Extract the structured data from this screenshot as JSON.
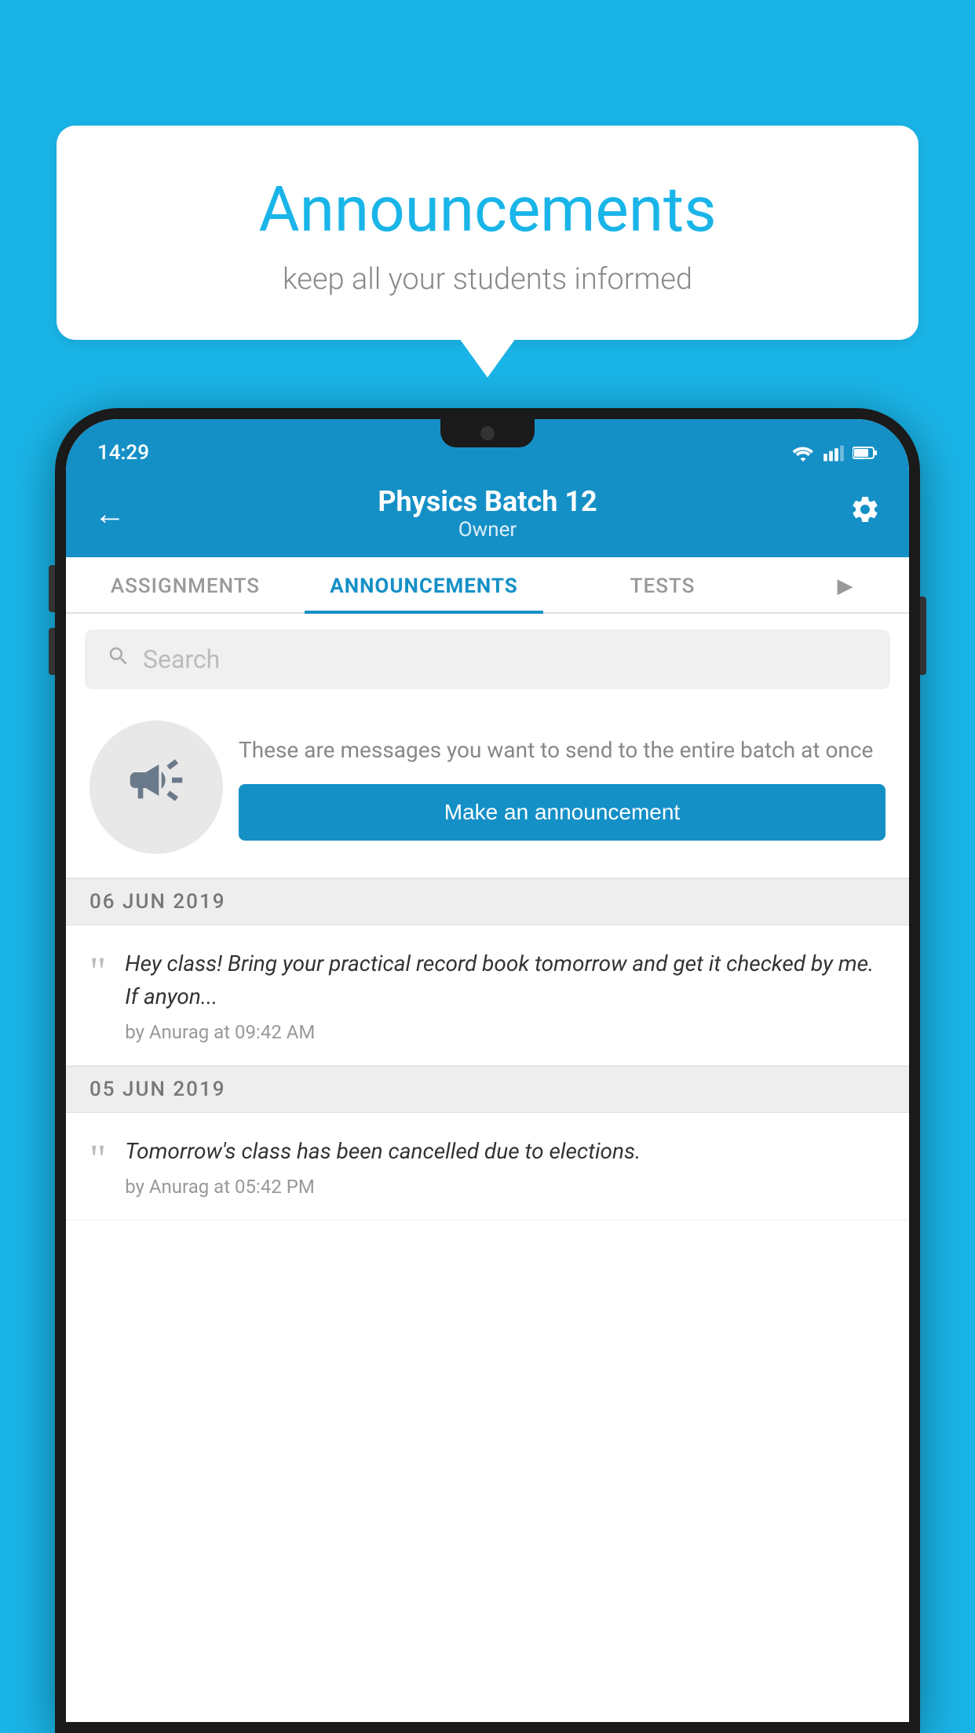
{
  "bubble": {
    "title": "Announcements",
    "subtitle": "keep all your students informed"
  },
  "statusBar": {
    "time": "14:29",
    "icons": [
      "wifi",
      "signal",
      "battery"
    ]
  },
  "header": {
    "title": "Physics Batch 12",
    "subtitle": "Owner",
    "back_label": "←",
    "gear_label": "⚙"
  },
  "tabs": [
    {
      "label": "ASSIGNMENTS",
      "active": false
    },
    {
      "label": "ANNOUNCEMENTS",
      "active": true
    },
    {
      "label": "TESTS",
      "active": false
    },
    {
      "label": "",
      "active": false,
      "partial": true
    }
  ],
  "search": {
    "placeholder": "Search"
  },
  "promo": {
    "description": "These are messages you want to send to the entire batch at once",
    "button_label": "Make an announcement"
  },
  "announcements": [
    {
      "date": "06  JUN  2019",
      "text": "Hey class! Bring your practical record book tomorrow and get it checked by me. If anyon...",
      "meta": "by Anurag at 09:42 AM"
    },
    {
      "date": "05  JUN  2019",
      "text": "Tomorrow's class has been cancelled due to elections.",
      "meta": "by Anurag at 05:42 PM"
    }
  ],
  "colors": {
    "primary": "#1590c7",
    "background": "#1ab5e8",
    "white": "#ffffff"
  }
}
